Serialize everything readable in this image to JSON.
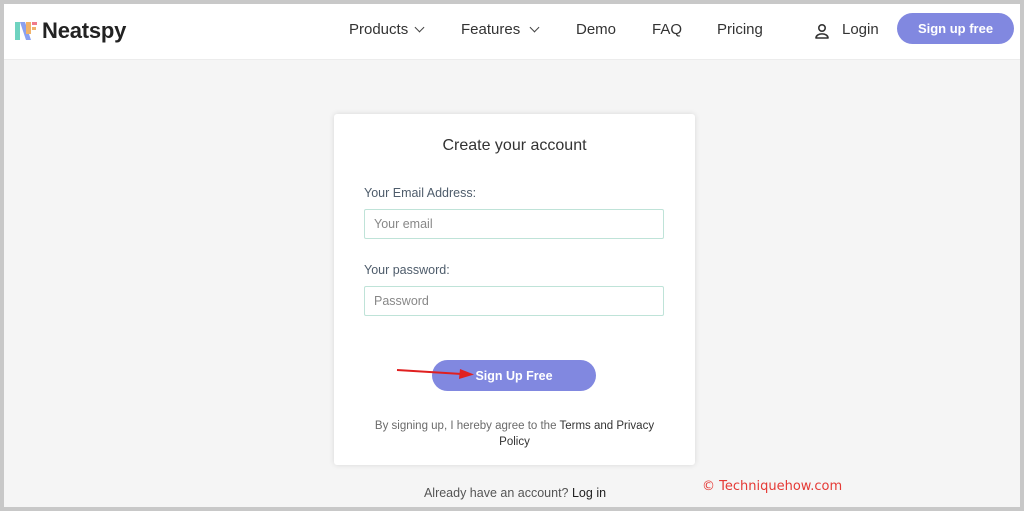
{
  "header": {
    "brand": "Neatspy",
    "nav": [
      {
        "label": "Products",
        "dropdown": true
      },
      {
        "label": "Features",
        "dropdown": true
      },
      {
        "label": "Demo",
        "dropdown": false
      },
      {
        "label": "FAQ",
        "dropdown": false
      },
      {
        "label": "Pricing",
        "dropdown": false
      }
    ],
    "login_label": "Login",
    "signup_label": "Sign up free"
  },
  "form": {
    "title": "Create your account",
    "email_label": "Your Email Address:",
    "email_placeholder": "Your email",
    "password_label": "Your password:",
    "password_placeholder": "Password",
    "submit_label": "Sign Up Free",
    "terms_prefix": "By signing up, I hereby agree to the",
    "terms_link": "Terms and Privacy",
    "terms_link2": "Policy"
  },
  "footer": {
    "already_text": "Already have an account?",
    "login_link": "Log in"
  },
  "watermark": "© Techniquehow.com",
  "colors": {
    "accent": "#8188e0",
    "annotation_arrow": "#e02020",
    "watermark": "#e53935"
  }
}
